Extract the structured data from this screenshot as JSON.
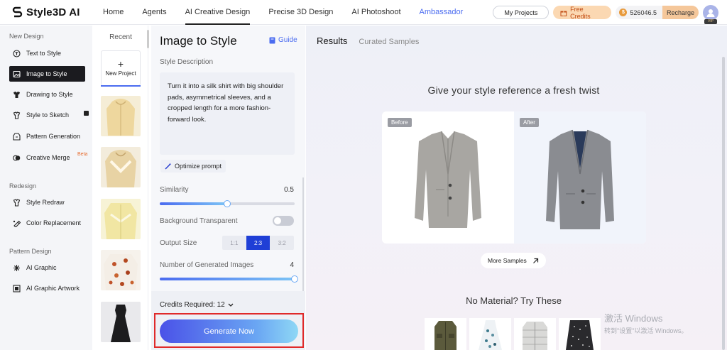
{
  "app": {
    "logo_text": "Style3D AI"
  },
  "nav": {
    "items": [
      {
        "label": "Home"
      },
      {
        "label": "Agents"
      },
      {
        "label": "AI Creative Design"
      },
      {
        "label": "Precise 3D Design"
      },
      {
        "label": "AI Photoshoot"
      },
      {
        "label": "Ambassador"
      }
    ],
    "active": "AI Creative Design"
  },
  "header_right": {
    "my_projects": "My Projects",
    "free_credits": "Free Credits",
    "balance": "526046.5",
    "recharge": "Recharge",
    "avatar_badge": "VIP"
  },
  "sidebar": {
    "sections": [
      {
        "title": "New Design"
      },
      {
        "title": "Redesign"
      },
      {
        "title": "Pattern Design"
      }
    ],
    "items": [
      {
        "label": "Text to Style",
        "icon": "text-style-icon"
      },
      {
        "label": "Image to Style",
        "icon": "image-style-icon"
      },
      {
        "label": "Drawing to Style",
        "icon": "drawing-style-icon"
      },
      {
        "label": "Style to Sketch",
        "icon": "sketch-icon"
      },
      {
        "label": "Pattern Generation",
        "icon": "pattern-icon"
      },
      {
        "label": "Creative Merge",
        "icon": "merge-icon"
      },
      {
        "label": "Style Redraw",
        "icon": "redraw-icon"
      },
      {
        "label": "Color Replacement",
        "icon": "color-icon"
      },
      {
        "label": "AI Graphic",
        "icon": "graphic-icon"
      },
      {
        "label": "AI Graphic Artwork",
        "icon": "artwork-icon"
      }
    ],
    "beta_badge": "Beta",
    "active_item": "Image to Style"
  },
  "recent": {
    "title": "Recent",
    "new_project": "New Project"
  },
  "panel": {
    "title": "Image to Style",
    "guide": "Guide",
    "style_description_label": "Style Description",
    "style_description": "Turn it into a silk shirt with big shoulder pads, asymmetrical sleeves, and a cropped length for a more fashion-forward look.",
    "optimize_prompt": "Optimize prompt",
    "similarity_label": "Similarity",
    "similarity_value": "0.5",
    "similarity_fraction": 0.5,
    "background_transparent_label": "Background Transparent",
    "background_transparent_on": false,
    "output_size_label": "Output Size",
    "output_sizes": [
      "1:1",
      "2:3",
      "3:2"
    ],
    "output_size_selected": "2:3",
    "num_images_label": "Number of Generated Images",
    "num_images_value": "4",
    "num_images_fraction": 1.0,
    "credits_required": "Credits Required: 12",
    "generate_button": "Generate Now"
  },
  "results": {
    "tab_results": "Results",
    "tab_curated": "Curated Samples",
    "heading": "Give your style reference a fresh twist",
    "before_tag": "Before",
    "after_tag": "After",
    "more_samples": "More Samples",
    "no_material": "No Material? Try These"
  },
  "watermark": {
    "line1": "激活 Windows",
    "line2": "转到\"设置\"以激活 Windows。"
  },
  "colors": {
    "accent": "#4b6cf0",
    "generate_gradient_start": "#4a52e8",
    "generate_gradient_end": "#8fd8f5",
    "highlight_outline": "#e02a2a",
    "sidebar_active": "#1b1b1f"
  }
}
